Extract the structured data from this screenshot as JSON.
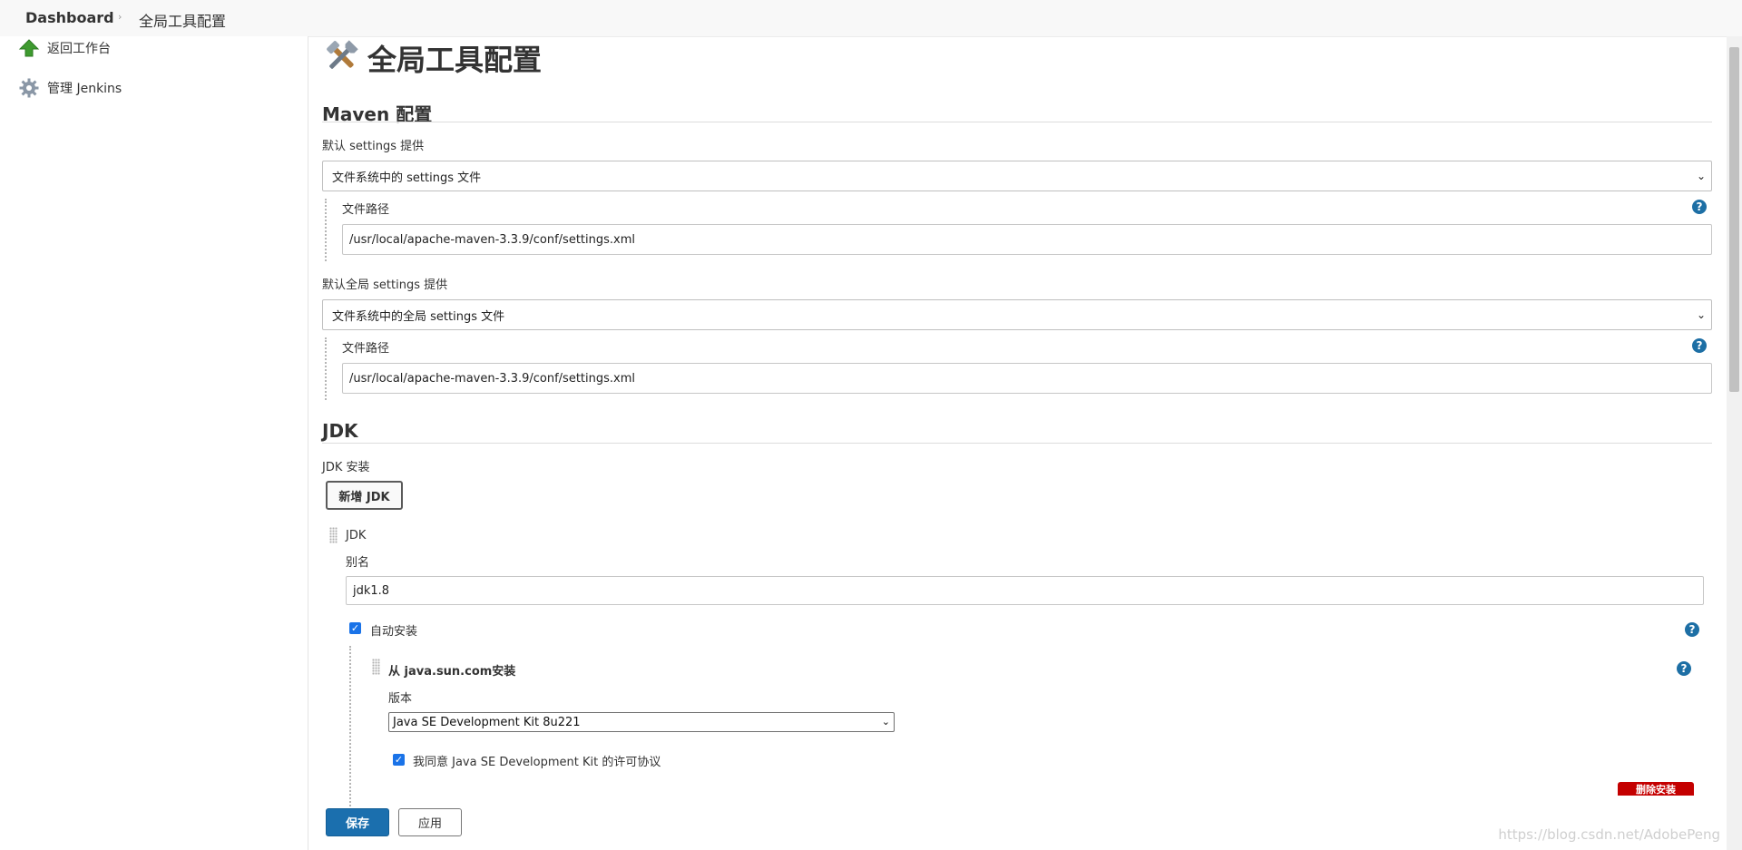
{
  "breadcrumb": {
    "root": "Dashboard",
    "separator": "›",
    "current": "全局工具配置"
  },
  "sidebar": {
    "items": [
      {
        "label": "返回工作台",
        "icon": "up-arrow-icon"
      },
      {
        "label": "管理 Jenkins",
        "icon": "gear-icon"
      }
    ]
  },
  "page": {
    "title": "全局工具配置",
    "title_icon": "tools-icon"
  },
  "maven": {
    "section_title": "Maven 配置",
    "settings_label": "默认 settings 提供",
    "settings_select": "文件系统中的 settings 文件",
    "settings_path_label": "文件路径",
    "settings_path_value": "/usr/local/apache-maven-3.3.9/conf/settings.xml",
    "global_label": "默认全局 settings 提供",
    "global_select": "文件系统中的全局 settings 文件",
    "global_path_label": "文件路径",
    "global_path_value": "/usr/local/apache-maven-3.3.9/conf/settings.xml"
  },
  "jdk": {
    "section_title": "JDK",
    "install_label": "JDK 安装",
    "add_button": "新增 JDK",
    "item_title": "JDK",
    "alias_label": "别名",
    "alias_value": "jdk1.8",
    "auto_install_label": "自动安装",
    "installer_title": "从 java.sun.com安装",
    "version_label": "版本",
    "version_value": "Java SE Development Kit 8u221",
    "license_label": "我同意 Java SE Development Kit 的许可协议",
    "delete_installer": "删除安装"
  },
  "help_glyph": "?",
  "check_glyph": "✓",
  "chevron_glyph": "⌄",
  "footer": {
    "save": "保存",
    "apply": "应用"
  },
  "watermark": "https://blog.csdn.net/AdobePeng",
  "colors": {
    "primary": "#1b6fae",
    "danger": "#c40000",
    "help": "#1d6fa5",
    "checkbox": "#1a73e8"
  }
}
